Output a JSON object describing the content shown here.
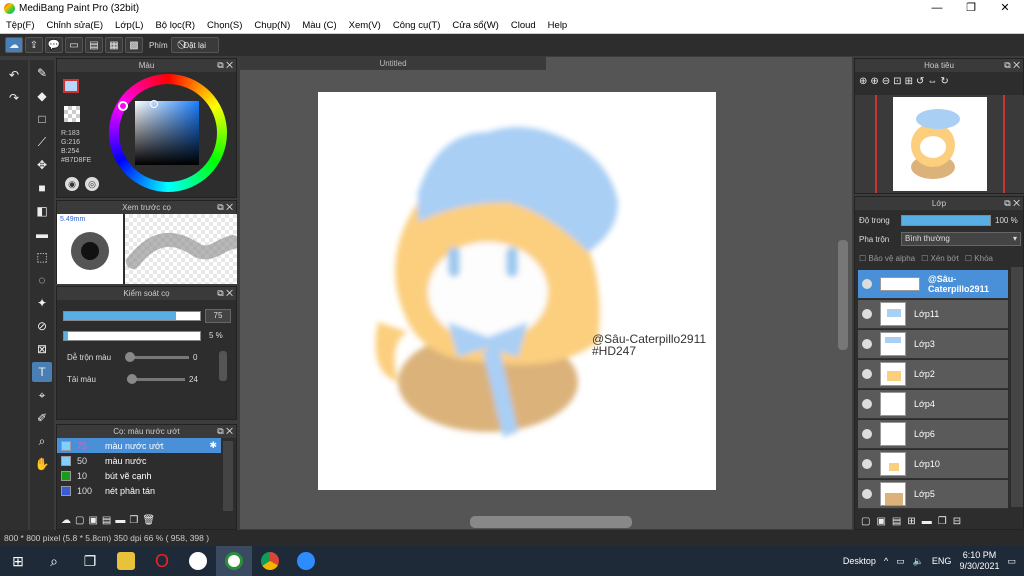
{
  "window": {
    "title": "MediBang Paint Pro (32bit)"
  },
  "menu": [
    "Tệp(F)",
    "Chỉnh sửa(E)",
    "Lớp(L)",
    "Bộ lọc(R)",
    "Chọn(S)",
    "Chụp(N)",
    "Màu (C)",
    "Xem(V)",
    "Công cụ(T)",
    "Cửa sổ(W)",
    "Cloud",
    "Help"
  ],
  "toolbar": {
    "phim_label": "Phím",
    "dat_lai_label": "Đặt lại"
  },
  "color_panel": {
    "title": "Màu",
    "rgb": [
      "R:183",
      "G:216",
      "B:254"
    ],
    "hex": "#B7D8FE",
    "fg_color": "#B7D8FE"
  },
  "preview_panel": {
    "title": "Xem trước cọ",
    "size": "5.49mm"
  },
  "brush_control": {
    "title": "Kiểm soát cọ",
    "size_value": "75",
    "opacity_value": "5 %",
    "blend_label": "Dễ trộn màu",
    "blend_value": "0",
    "reload_label": "Tải màu",
    "reload_value": "24"
  },
  "brush_list": {
    "title": "Cọ: màu nước ướt",
    "items": [
      {
        "num": "75",
        "name": "màu nước ướt",
        "color": "#7fd0ff"
      },
      {
        "num": "50",
        "name": "màu nước",
        "color": "#7fd0ff"
      },
      {
        "num": "10",
        "name": "bút vẽ cạnh",
        "color": "#1a9a1a"
      },
      {
        "num": "100",
        "name": "nét phân tán",
        "color": "#3a5bd8"
      }
    ]
  },
  "canvas": {
    "tab_title": "Untitled",
    "watermark_line1": "@Sâu-Caterpillo2911",
    "watermark_line2": "#HD247"
  },
  "navigator": {
    "title": "Hoa tiêu"
  },
  "layers_panel": {
    "title": "Lớp",
    "opacity_label": "Độ trong",
    "opacity_value": "100 %",
    "opacity_level": 1.0,
    "blend_label": "Pha trộn",
    "blend_value": "Bình thường",
    "protect_alpha": "Bảo vệ alpha",
    "clipping": "Xén bớt",
    "lock": "Khóa",
    "layers": [
      {
        "name": "@Sâu-Caterpillo2911"
      },
      {
        "name": "Lớp11"
      },
      {
        "name": "Lớp3"
      },
      {
        "name": "Lớp2"
      },
      {
        "name": "Lớp4"
      },
      {
        "name": "Lớp6"
      },
      {
        "name": "Lớp10"
      },
      {
        "name": "Lớp5"
      }
    ]
  },
  "status": {
    "text": "800 * 800 pixel   (5.8 * 5.8cm)   350 dpi   66 %   ( 958, 398 )"
  },
  "taskbar": {
    "desktop_label": "Desktop",
    "lang": "ENG",
    "time": "6:10 PM",
    "date": "9/30/2021"
  }
}
